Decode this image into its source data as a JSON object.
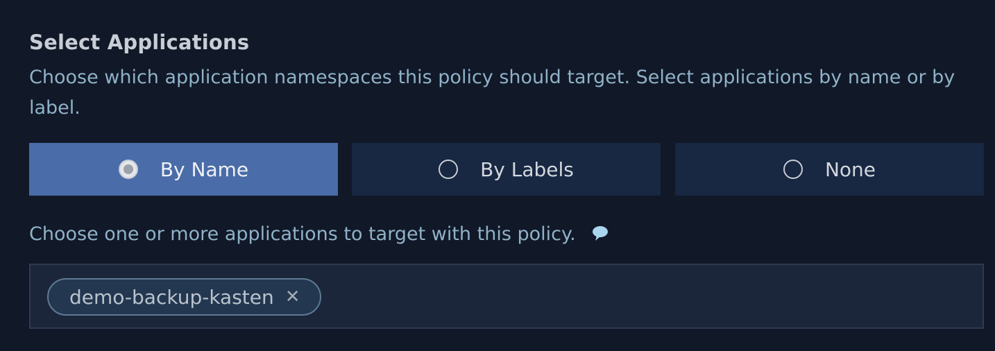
{
  "section": {
    "title": "Select Applications",
    "description": "Choose which application namespaces this policy should target. Select applications by name or by label."
  },
  "selection_mode": {
    "options": [
      {
        "label": "By Name",
        "selected": true
      },
      {
        "label": "By Labels",
        "selected": false
      },
      {
        "label": "None",
        "selected": false
      }
    ]
  },
  "applications": {
    "helper_text": "Choose one or more applications to target with this policy.",
    "help_icon": "speech-bubble-icon",
    "selected_chips": [
      {
        "label": "demo-backup-kasten",
        "remove_icon": "close-icon",
        "remove_glyph": "✕"
      }
    ]
  },
  "colors": {
    "background": "#111827",
    "selected_segment": "#4a6ca8",
    "unselected_segment": "#182742",
    "helper_text": "#8fb2c8"
  }
}
